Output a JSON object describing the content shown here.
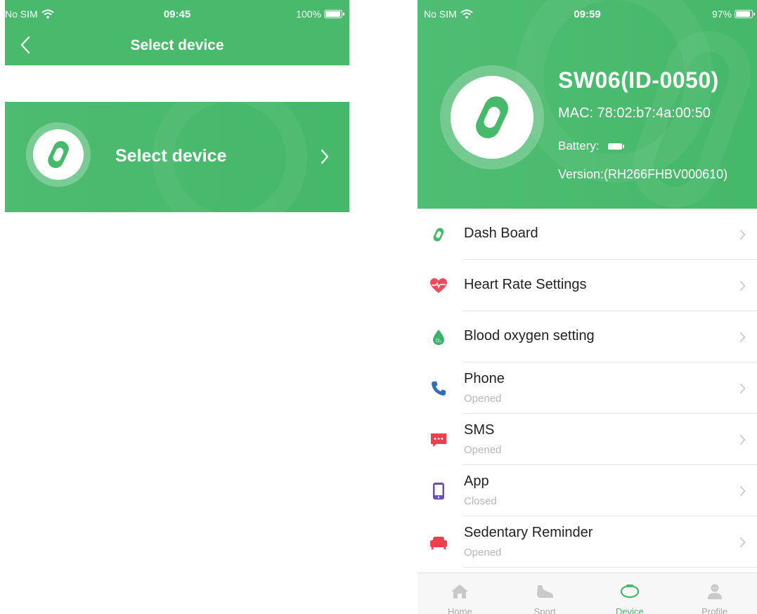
{
  "colors": {
    "brand_green": "#49b96b",
    "chevron": "#c4c4c4",
    "subtext": "#b7b7b7"
  },
  "left": {
    "status": {
      "carrier": "No SIM",
      "time": "09:45",
      "battery": "100%"
    },
    "nav": {
      "title": "Select device"
    },
    "card": {
      "label": "Select device"
    }
  },
  "right": {
    "status": {
      "carrier": "No SIM",
      "time": "09:59",
      "battery": "97%"
    },
    "device": {
      "name": "SW06(ID-0050)",
      "mac": "MAC: 78:02:b7:4a:00:50",
      "battery_label": "Battery:",
      "version": "Version:(RH266FHBV000610)"
    },
    "menu": [
      {
        "label": "Dash Board",
        "icon": "band-icon"
      },
      {
        "label": "Heart Rate Settings",
        "icon": "heart-icon"
      },
      {
        "label": "Blood oxygen setting",
        "icon": "oxygen-drop-icon"
      },
      {
        "label": "Phone",
        "status": "Opened",
        "icon": "phone-icon"
      },
      {
        "label": "SMS",
        "status": "Opened",
        "icon": "sms-icon"
      },
      {
        "label": "App",
        "status": "Closed",
        "icon": "app-icon"
      },
      {
        "label": "Sedentary Reminder",
        "status": "Opened",
        "icon": "sofa-icon"
      }
    ],
    "tabs": [
      {
        "label": "Home",
        "icon": "home-icon",
        "active": false
      },
      {
        "label": "Sport",
        "icon": "shoe-icon",
        "active": false
      },
      {
        "label": "Device",
        "icon": "watch-icon",
        "active": true
      },
      {
        "label": "Profile",
        "icon": "person-icon",
        "active": false
      }
    ]
  }
}
